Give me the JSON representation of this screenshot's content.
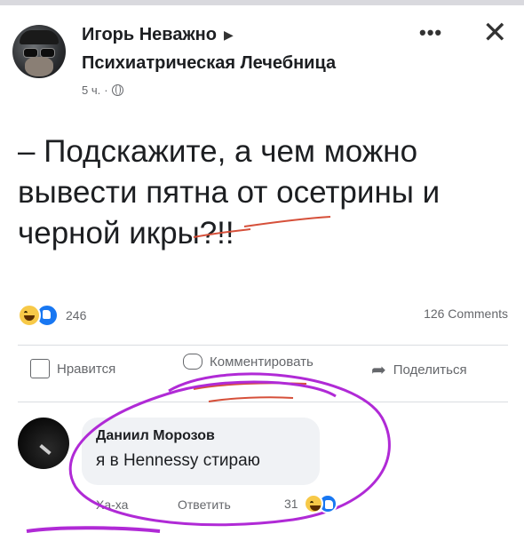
{
  "post": {
    "author": "Игорь Неважно",
    "group": "Психиатрическая Лечебница",
    "time": "5 ч.",
    "text": "– Подскажите, а чем можно вывести пятна от осетрины и черной икры?!!"
  },
  "reactions": {
    "count": "246",
    "comments": "126 Comments"
  },
  "actions": {
    "like": "Нравится",
    "comment": "Комментировать",
    "share": "Поделиться"
  },
  "comment": {
    "author": "Даниил Морозов",
    "text": "я в Hennessy стираю",
    "reply_haha": "Ха-ха",
    "reply": "Ответить",
    "reaction_count": "31"
  },
  "colors": {
    "annotation": "#b02ad6",
    "underline": "#d6503a",
    "like_blue": "#1877f2"
  },
  "icons": [
    "arrow-right-icon",
    "globe-icon",
    "more-icon",
    "close-icon",
    "like-icon",
    "comment-icon",
    "share-icon",
    "haha-emoji-icon",
    "like-emoji-icon"
  ]
}
